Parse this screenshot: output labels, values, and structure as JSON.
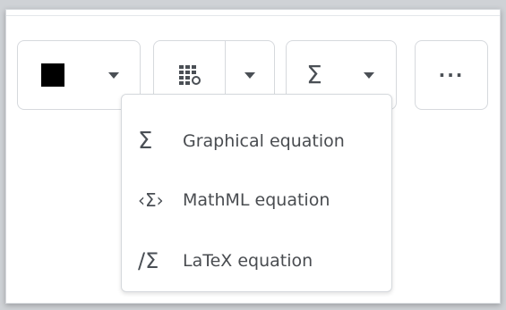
{
  "toolbar": {
    "color_button": {
      "swatch_color": "#000000",
      "icon": "chevron-down-icon"
    },
    "table_button": {
      "icon": "table-grid-icon",
      "caret_icon": "chevron-down-icon"
    },
    "equation_button": {
      "symbol": "Σ",
      "caret_icon": "chevron-down-icon"
    },
    "more_button": {
      "symbol": "···"
    }
  },
  "equation_menu": {
    "items": [
      {
        "icon": "sigma-icon",
        "icon_text": "Σ",
        "label": "Graphical equation"
      },
      {
        "icon": "mathml-icon",
        "icon_text": "‹Σ›",
        "label": "MathML equation"
      },
      {
        "icon": "latex-icon",
        "icon_text": "/Σ",
        "label": "LaTeX equation"
      }
    ]
  },
  "colors": {
    "icon": "#4a4f55",
    "border": "#d6d9dd",
    "text": "#494c50"
  }
}
